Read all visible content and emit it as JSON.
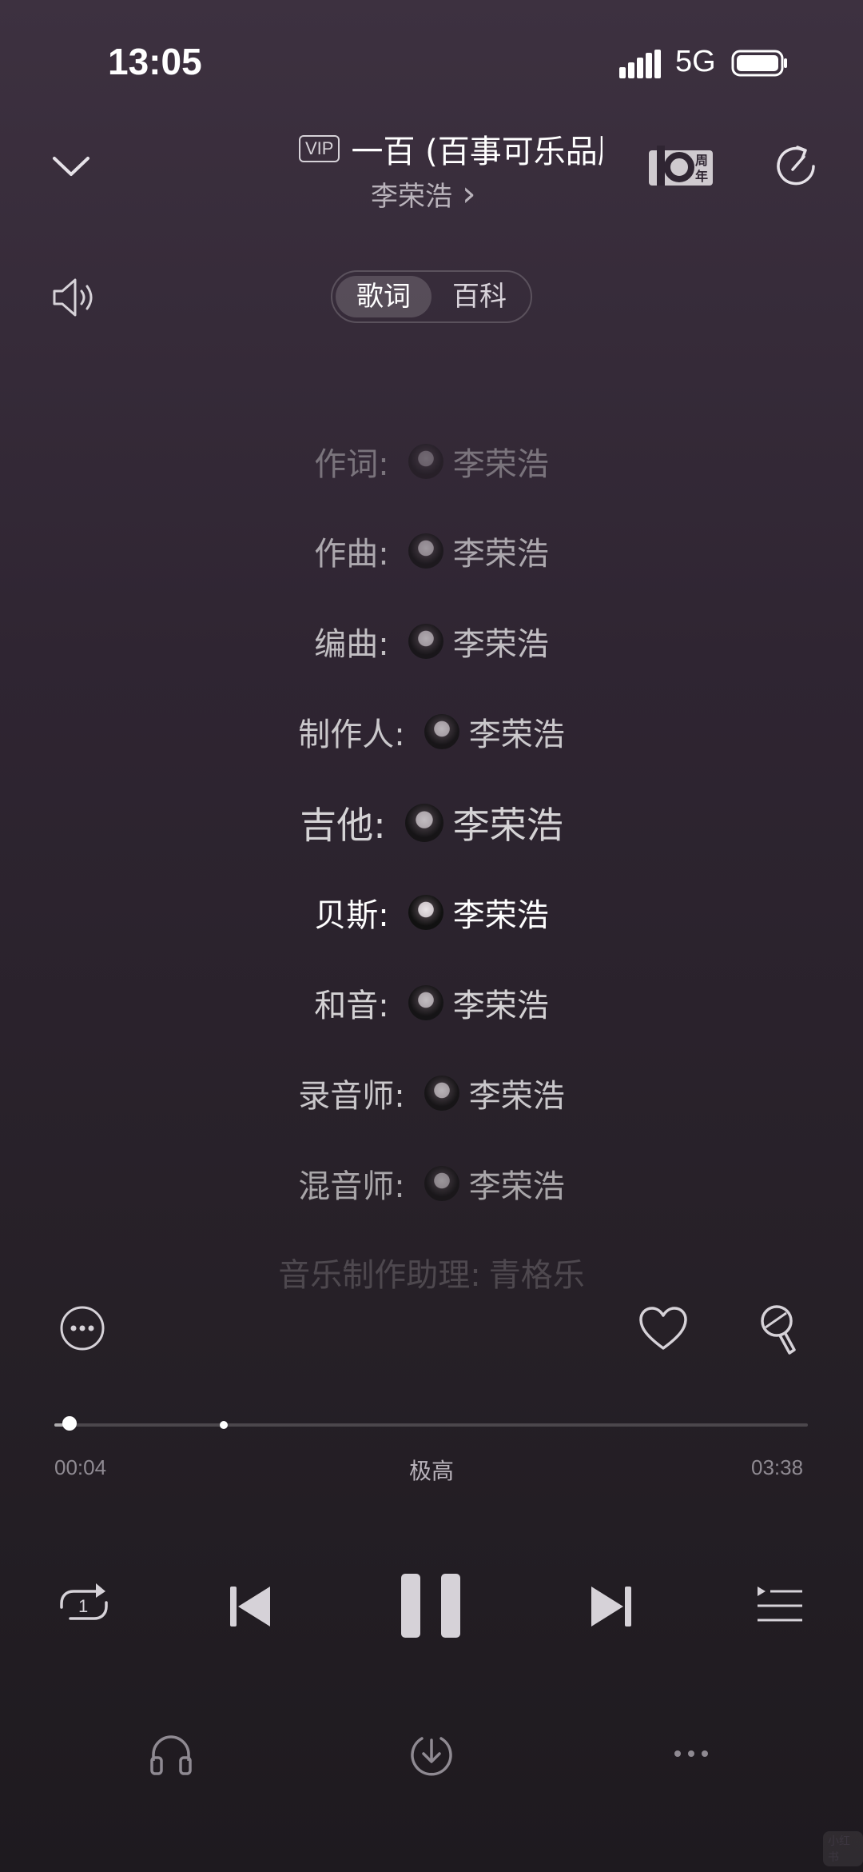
{
  "status_bar": {
    "time": "13:05",
    "network": "5G"
  },
  "header": {
    "vip_label": "VIP",
    "song_title": "一百 (百事可乐品牌",
    "artist": "李荣浩",
    "artist_chevron": "›"
  },
  "tabs": [
    {
      "label": "歌词",
      "active": true
    },
    {
      "label": "百科",
      "active": false
    }
  ],
  "credits": [
    {
      "role": "作词:",
      "name": "李荣浩",
      "opacity": 0.35
    },
    {
      "role": "作曲:",
      "name": "李荣浩",
      "opacity": 0.6
    },
    {
      "role": "编曲:",
      "name": "李荣浩",
      "opacity": 0.7
    },
    {
      "role": "制作人:",
      "name": "李荣浩",
      "opacity": 0.75
    },
    {
      "role": "吉他:",
      "name": "李荣浩",
      "opacity": 0.8
    },
    {
      "role": "贝斯:",
      "name": "李荣浩",
      "opacity": 1.0
    },
    {
      "role": "和音:",
      "name": "李荣浩",
      "opacity": 0.8
    },
    {
      "role": "录音师:",
      "name": "李荣浩",
      "opacity": 0.75
    },
    {
      "role": "混音师:",
      "name": "李荣浩",
      "opacity": 0.6
    },
    {
      "role": "音乐制作助理:",
      "name": "青格乐",
      "opacity": 0.18
    }
  ],
  "progress": {
    "current": "00:04",
    "quality": "极高",
    "total": "03:38",
    "played_fraction": 0.02,
    "buffered_fraction": 0.225
  },
  "repeat_badge": "1",
  "watermark": "小红书",
  "icons": {
    "collapse": "chevron-down-icon",
    "anniversary": "anniversary-10-badge-icon",
    "share": "share-icon",
    "volume": "volume-icon",
    "more": "more-circle-icon",
    "like": "heart-icon",
    "sing": "microphone-icon",
    "repeat": "repeat-one-icon",
    "previous": "previous-icon",
    "pause": "pause-icon",
    "next": "next-icon",
    "playlist": "playlist-icon",
    "sound_effect": "headphones-icon",
    "download": "download-icon",
    "more_menu": "more-dots-icon"
  }
}
